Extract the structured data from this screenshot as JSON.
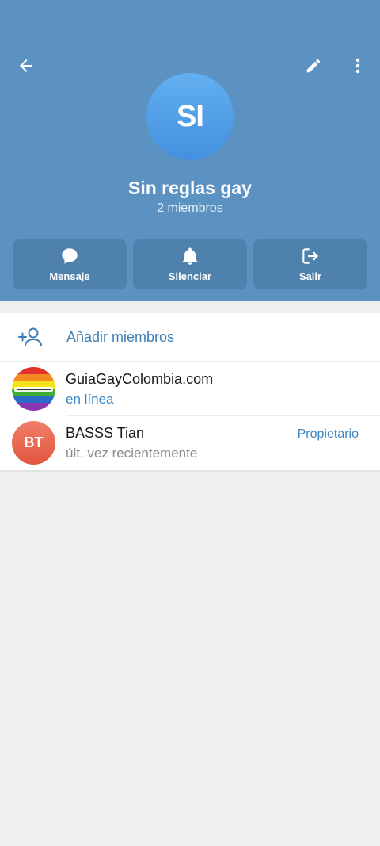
{
  "header": {
    "avatar_initials": "SI",
    "title": "Sin reglas gay",
    "subtitle": "2 miembros",
    "icons": {
      "back": "arrow-left-icon",
      "edit": "pencil-icon",
      "more": "more-vertical-icon"
    }
  },
  "actions": [
    {
      "label": "Mensaje",
      "icon": "chat-bubble-icon"
    },
    {
      "label": "Silenciar",
      "icon": "bell-icon"
    },
    {
      "label": "Salir",
      "icon": "logout-icon"
    }
  ],
  "add_members": {
    "label": "Añadir miembros",
    "icon": "add-person-icon"
  },
  "members": [
    {
      "name": "GuiaGayColombia.com",
      "status": "en línea",
      "role": ""
    },
    {
      "name": "BASSS Tian",
      "status": "últ. vez recientemente",
      "role": "Propietario",
      "initials": "BT"
    }
  ],
  "colors": {
    "header": "#5b92c1",
    "action_bg": "#4f81ad",
    "accent": "#3c7fb6",
    "owner_avatar": "#e1553e"
  }
}
